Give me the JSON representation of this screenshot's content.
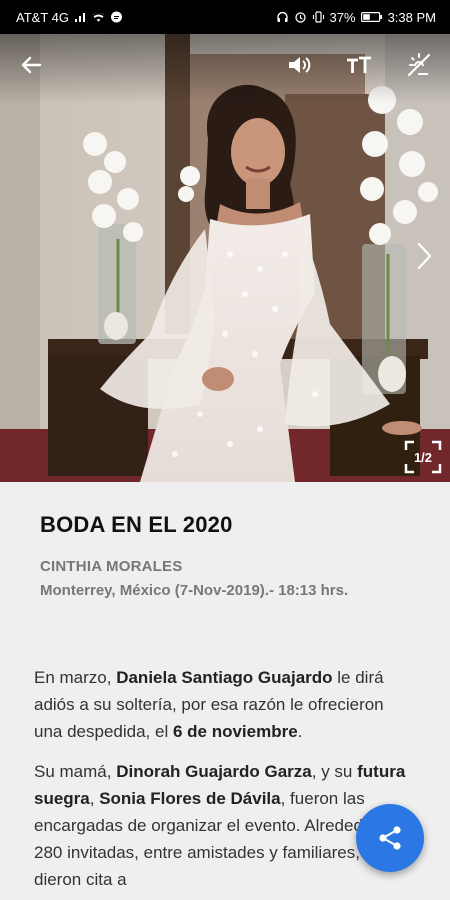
{
  "status_bar": {
    "carrier": "AT&T 4G",
    "battery": "37%",
    "time": "3:38 PM"
  },
  "gallery": {
    "counter": "1/2"
  },
  "article": {
    "title": "BODA EN EL 2020",
    "author": "CINTHIA MORALES",
    "dateline": "Monterrey, México (7-Nov-2019).- 18:13 hrs.",
    "p1_a": "En marzo, ",
    "p1_b": "Daniela Santiago Guajardo",
    "p1_c": " le dirá adiós a su soltería, por esa razón le ofrecieron una despedida, el ",
    "p1_d": "6 de noviembre",
    "p1_e": ".",
    "p2_a": "Su mamá, ",
    "p2_b": "Dinorah Guajardo Garza",
    "p2_c": ", y su ",
    "p2_d": "futura suegra",
    "p2_e": ", ",
    "p2_f": "Sonia Flores de Dávila",
    "p2_g": ", fueron las encargadas de organizar el evento. Alrededor de 280 invitadas, entre amistades y familiares, se dieron cita a"
  },
  "icons": {
    "back": "arrow-left-icon",
    "audio": "volume-icon",
    "text_size": "text-size-icon",
    "lights": "no-light-icon",
    "next": "chevron-right-icon",
    "fullscreen": "fullscreen-icon",
    "share": "share-icon"
  },
  "colors": {
    "fab": "#2b78e4",
    "title": "#111111",
    "meta": "#777777"
  }
}
